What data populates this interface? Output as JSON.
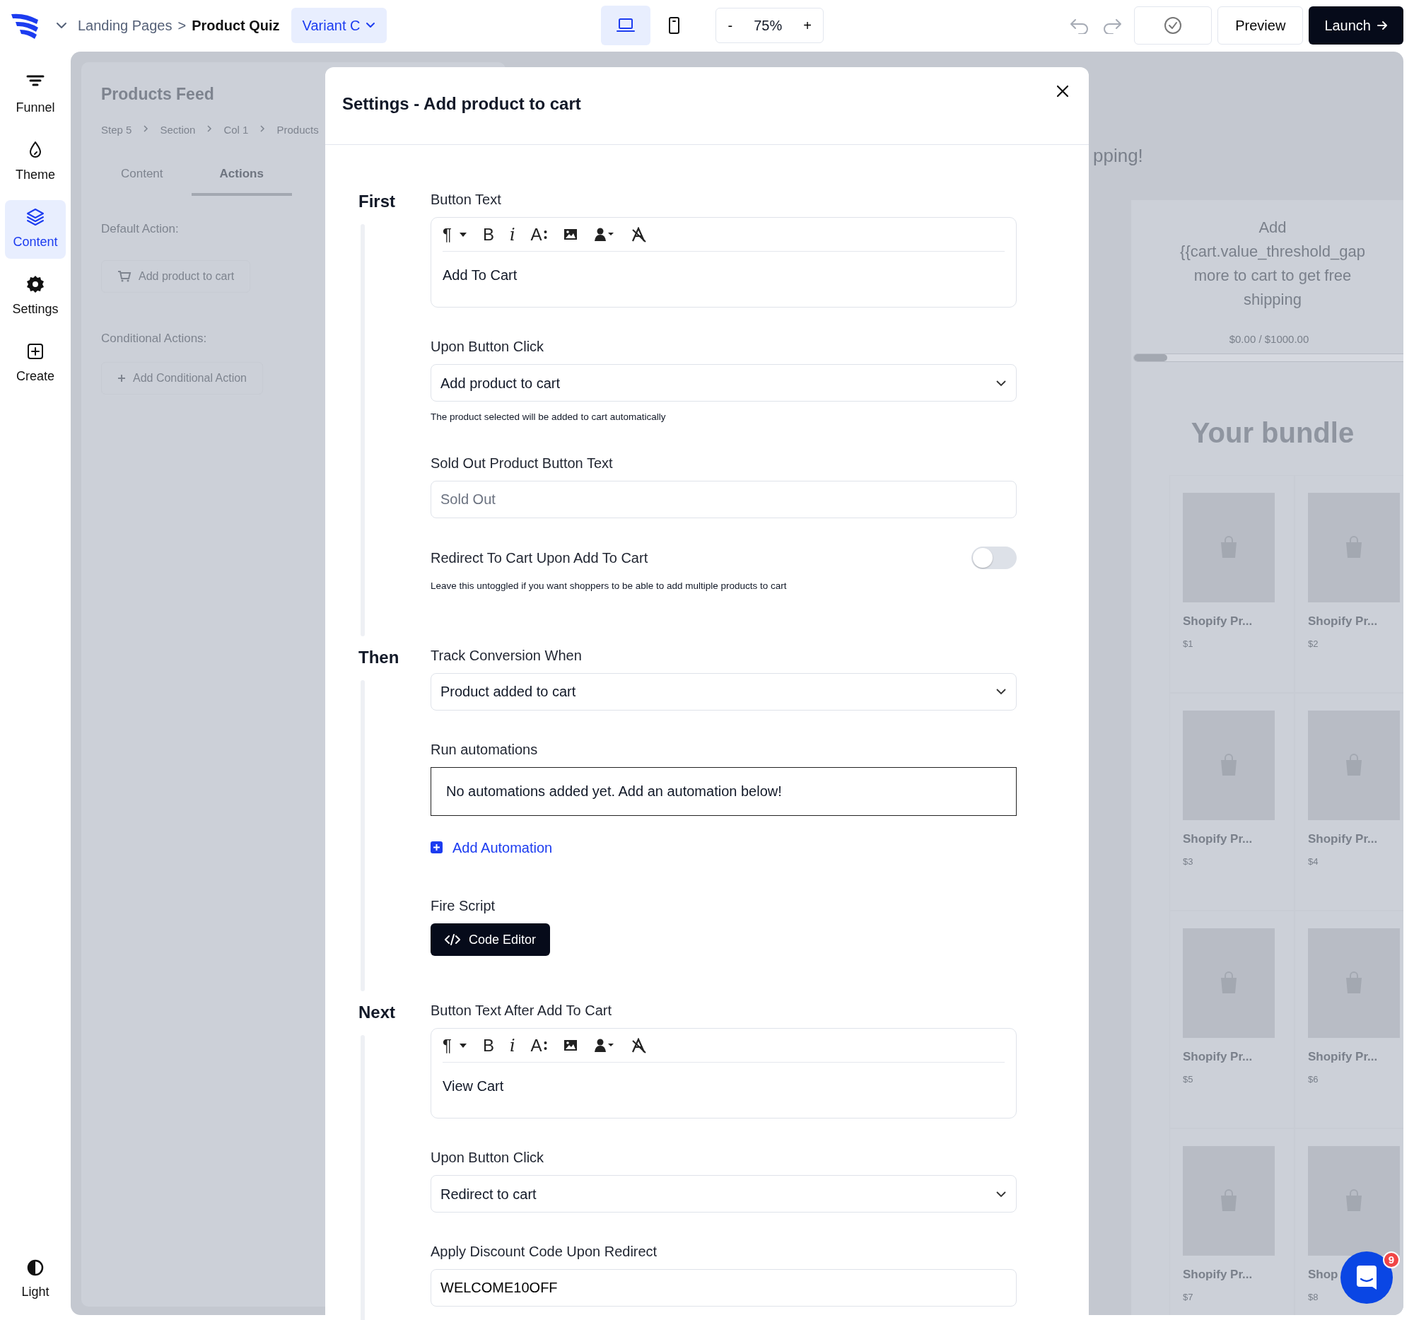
{
  "topbar": {
    "parent_page": "Landing Pages",
    "separator": ">",
    "page_title": "Product Quiz",
    "variant": "Variant C",
    "devices": [
      {
        "kind": "desktop",
        "selected": true
      },
      {
        "kind": "mobile",
        "selected": false
      }
    ],
    "zoom": {
      "minus": "-",
      "value": "75%",
      "plus": "+"
    },
    "preview": "Preview",
    "launch": "Launch"
  },
  "sidebar": {
    "items": [
      {
        "kind": "funnel",
        "label": "Funnel",
        "selected": false
      },
      {
        "kind": "theme",
        "label": "Theme",
        "selected": false
      },
      {
        "kind": "content",
        "label": "Content",
        "selected": true
      },
      {
        "kind": "settings",
        "label": "Settings",
        "selected": false
      },
      {
        "kind": "create",
        "label": "Create",
        "selected": false
      }
    ],
    "mode_toggle": "Light"
  },
  "background": {
    "left_panel": {
      "title": "Products Feed",
      "breadcrumb": [
        "Step 5",
        "Section",
        "Col 1",
        "Products"
      ],
      "tabs": [
        {
          "label": "Content",
          "selected": false
        },
        {
          "label": "Actions",
          "selected": true
        }
      ],
      "default_label": "Default Action:",
      "default_action": "Add product to cart",
      "conditional_label": "Conditional Actions:",
      "add_conditional": "Add Conditional Action"
    },
    "preview": {
      "banner_fragment": "pping!",
      "progress_lines": [
        "Add",
        "{{cart.value_threshold_gap",
        "more to cart to get free",
        "shipping"
      ],
      "cart_total": "$0.00 / $1000.00",
      "level": 0.12,
      "heading": "Your bundle",
      "products": [
        {
          "title": "Shopify Pr...",
          "price": "$1"
        },
        {
          "title": "Shopify Pr...",
          "price": "$2"
        },
        {
          "title": "Shopify Pr...",
          "price": "$3"
        },
        {
          "title": "Shopify Pr...",
          "price": "$4"
        },
        {
          "title": "Shopify Pr...",
          "price": "$5"
        },
        {
          "title": "Shopify Pr...",
          "price": "$6"
        },
        {
          "title": "Shopify Pr...",
          "price": "$7"
        },
        {
          "title": "Shop",
          "price": "$8"
        }
      ]
    }
  },
  "modal": {
    "title": "Settings - Add product to cart",
    "sections": [
      {
        "label": "First",
        "fields": [
          {
            "kind": "editor",
            "label": "Button Text",
            "value": "Add To Cart",
            "toolbar": [
              {
                "kind": "paragraph",
                "glyph": "¶"
              },
              {
                "kind": "bold",
                "glyph": "B"
              },
              {
                "kind": "italic",
                "glyph": "i"
              },
              {
                "kind": "font",
                "glyph": "A"
              },
              {
                "kind": "image"
              },
              {
                "kind": "person"
              },
              {
                "kind": "clear"
              }
            ]
          },
          {
            "kind": "select",
            "label": "Upon Button Click",
            "value": "Add product to cart",
            "help": "The product selected will be added to cart automatically"
          },
          {
            "kind": "input",
            "label": "Sold Out Product Button Text",
            "placeholder": "Sold Out"
          },
          {
            "kind": "toggle",
            "label": "Redirect To Cart Upon Add To Cart",
            "on": false,
            "help": "Leave this untoggled if you want shoppers to be able to add multiple products to cart"
          }
        ]
      },
      {
        "label": "Then",
        "fields": [
          {
            "kind": "select",
            "label": "Track Conversion When",
            "value": "Product added to cart"
          },
          {
            "kind": "notice",
            "label": "Run automations",
            "value": "No automations added yet. Add an automation below!"
          },
          {
            "kind": "link",
            "value": "Add Automation"
          },
          {
            "kind": "code",
            "label": "Fire Script",
            "value": "Code Editor"
          }
        ]
      },
      {
        "label": "Next",
        "fields": [
          {
            "kind": "editor",
            "label": "Button Text After Add To Cart",
            "value": "View Cart",
            "toolbar": [
              {
                "kind": "paragraph",
                "glyph": "¶"
              },
              {
                "kind": "bold",
                "glyph": "B"
              },
              {
                "kind": "italic",
                "glyph": "i"
              },
              {
                "kind": "font",
                "glyph": "A"
              },
              {
                "kind": "image"
              },
              {
                "kind": "person"
              },
              {
                "kind": "clear"
              }
            ]
          },
          {
            "kind": "select",
            "label": "Upon Button Click",
            "value": "Redirect to cart"
          },
          {
            "kind": "input",
            "label": "Apply Discount Code Upon Redirect",
            "value": "WELCOME10OFF"
          }
        ]
      }
    ]
  },
  "chat": {
    "badge": "9"
  }
}
